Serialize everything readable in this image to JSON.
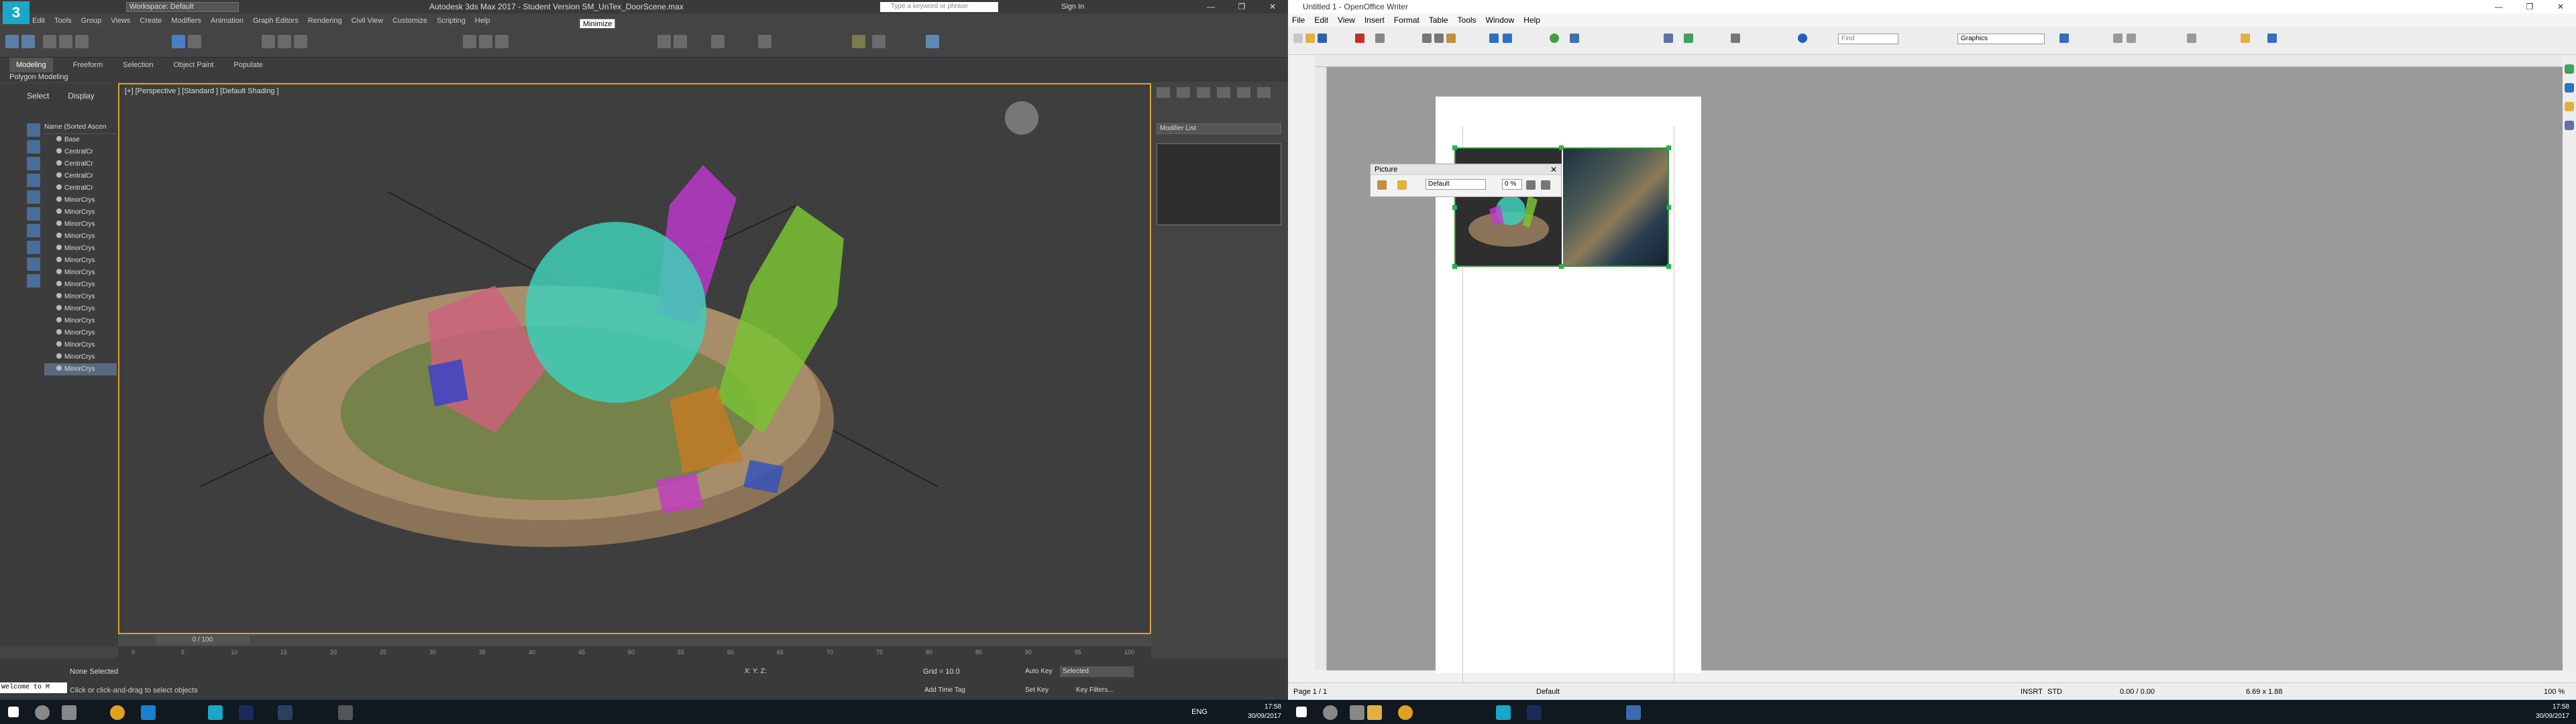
{
  "max": {
    "logo": "3",
    "title": "Autodesk 3ds Max 2017 - Student Version   SM_UnTex_DoorScene.max",
    "workspace": "Workspace: Default",
    "search_placeholder": "Type a keyword or phrase",
    "sign_in": "Sign In",
    "minimize_tooltip": "Minimize",
    "menu": [
      "Edit",
      "Tools",
      "Group",
      "Views",
      "Create",
      "Modifiers",
      "Animation",
      "Graph Editors",
      "Rendering",
      "Civil View",
      "Customize",
      "Scripting",
      "Help"
    ],
    "ribbon_tabs": [
      "Modeling",
      "Freeform",
      "Selection",
      "Object Paint",
      "Populate"
    ],
    "ribbon_sub": "Polygon Modeling",
    "scene_tabs": [
      "Select",
      "Display"
    ],
    "scene_header": "Name (Sorted Ascen",
    "scene_items": [
      "Base",
      "CentralCr",
      "CentralCr",
      "CentralCr",
      "CentralCr",
      "MinorCrys",
      "MinorCrys",
      "MinorCrys",
      "MinorCrys",
      "MinorCrys",
      "MinorCrys",
      "MinorCrys",
      "MinorCrys",
      "MinorCrys",
      "MinorCrys",
      "MinorCrys",
      "MinorCrys",
      "MinorCrys",
      "MinorCrys",
      "MinorCrys"
    ],
    "viewport_label": "[+] [Perspective ] [Standard ] [Default Shading ]",
    "modifier_list": "Modifier List",
    "time_counter": "0 / 100",
    "tick_labels": [
      "0",
      "5",
      "10",
      "15",
      "20",
      "25",
      "30",
      "35",
      "40",
      "45",
      "50",
      "55",
      "60",
      "65",
      "70",
      "75",
      "80",
      "85",
      "90",
      "95",
      "100"
    ],
    "status_selection": "None Selected",
    "status_hint": "Click or click-and-drag to select objects",
    "maxscript": "Welcome to M",
    "coords": "X:              Y:              Z:",
    "grid": "Grid = 10.0",
    "add_time_tag": "Add Time Tag",
    "auto_key": "Auto Key",
    "set_key": "Set Key",
    "selected": "Selected",
    "key_filters": "Key Filters...",
    "tray_lang": "ENG",
    "tray_time": "17:58",
    "tray_date": "30/09/2017"
  },
  "writer": {
    "title": "Untitled 1 - OpenOffice Writer",
    "menu": [
      "File",
      "Edit",
      "View",
      "Insert",
      "Format",
      "Table",
      "Tools",
      "Window",
      "Help"
    ],
    "find_placeholder": "Find",
    "style": "Graphics",
    "picture_toolbar": {
      "title": "Picture",
      "mode": "Default",
      "percent": "0 %"
    },
    "status_page": "Page 1 / 1",
    "status_style": "Default",
    "status_insrt": "INSRT",
    "status_std": "STD",
    "status_pos": "0.00 / 0.00",
    "status_size": "6.69 x 1.88",
    "status_zoom": "100 %",
    "tray_time": "17:58",
    "tray_date": "30/09/2017"
  }
}
